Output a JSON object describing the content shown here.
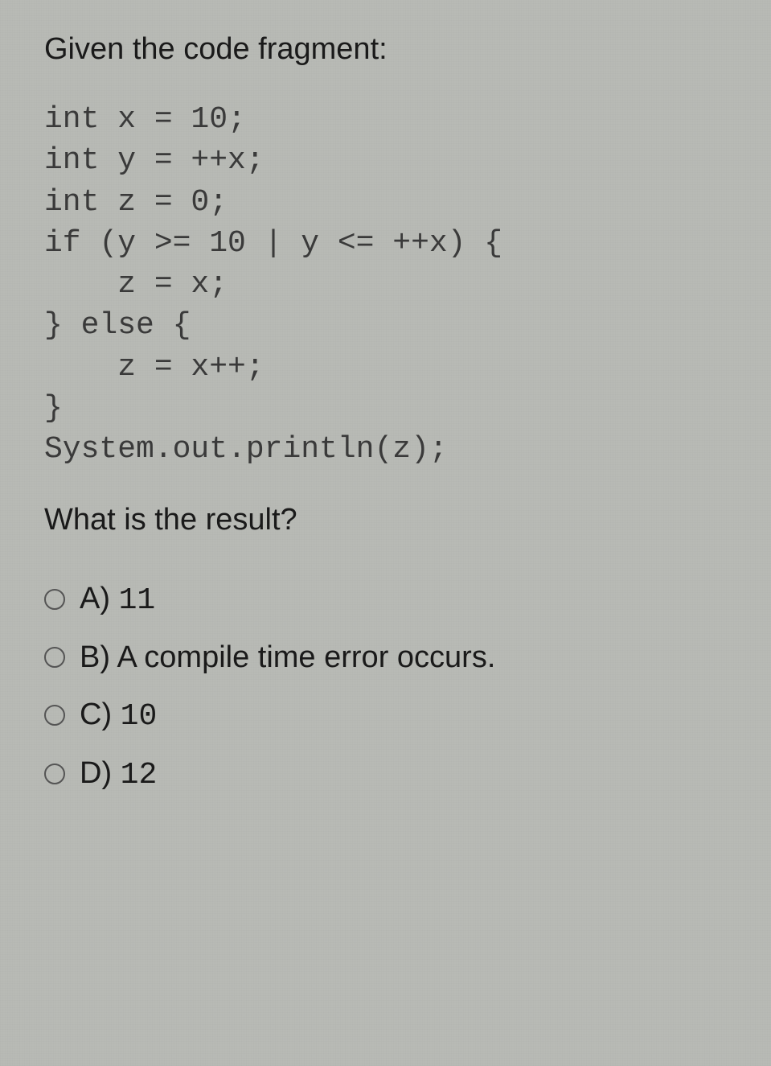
{
  "question": {
    "intro": "Given the code fragment:",
    "code": "int x = 10;\nint y = ++x;\nint z = 0;\nif (y >= 10 | y <= ++x) {\n    z = x;\n} else {\n    z = x++;\n}\nSystem.out.println(z);",
    "prompt": "What is the result?"
  },
  "options": [
    {
      "letter": "A)",
      "text": "11",
      "mono": true
    },
    {
      "letter": "B)",
      "text": "A compile time error occurs.",
      "mono": false
    },
    {
      "letter": "C)",
      "text": "10",
      "mono": true
    },
    {
      "letter": "D)",
      "text": "12",
      "mono": true
    }
  ]
}
